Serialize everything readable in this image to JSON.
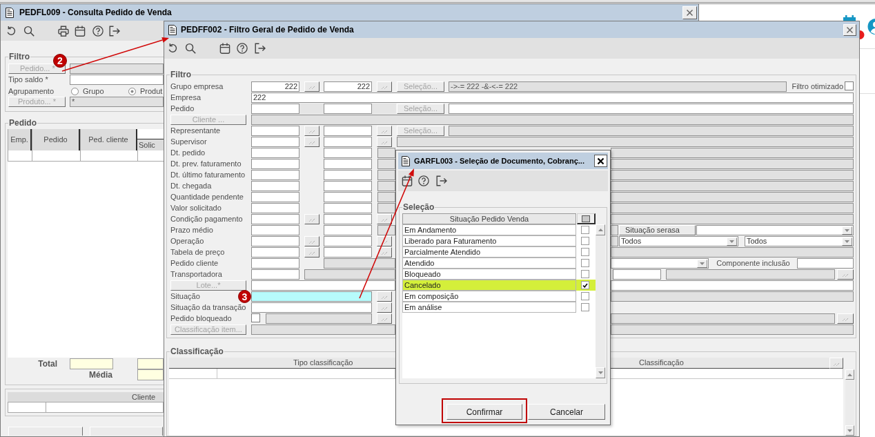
{
  "back_window": {
    "title": "PEDFL009 - Consulta Pedido de Venda",
    "filter": {
      "legend": "Filtro",
      "order_button": {
        "label": "Pedido... *",
        "disabled": true
      },
      "order_field": {
        "disabled": true
      },
      "balance_type_label": "Tipo saldo *",
      "balance_type_field": {
        "disabled": false
      },
      "grouping_label": "Agrupamento",
      "grouping_options": [
        {
          "label": "Grupo",
          "selected": false
        },
        {
          "label": "Produt",
          "selected": true
        }
      ],
      "product_button": {
        "label": "Produto... *",
        "disabled": true
      },
      "product_field": {
        "value": "*",
        "disabled": true
      }
    },
    "orders": {
      "legend": "Pedido",
      "columns": [
        "Emp.",
        "Pedido",
        "Ped. cliente"
      ],
      "column_4": "Solic",
      "total_label": "Total",
      "average_label": "Média"
    },
    "client_table": {
      "columns": [
        "Cliente"
      ]
    }
  },
  "filter_window": {
    "title": "PEDFF002 - Filtro Geral de Pedido de Venda",
    "legend": "Filtro",
    "rows": [
      {
        "label": {
          "kind": "text",
          "text": "Grupo empresa"
        },
        "cells": [
          {
            "kind": "field",
            "value": "222",
            "disabled": false,
            "focused": false
          },
          {
            "kind": "lookup"
          },
          {
            "kind": "field",
            "value": "222",
            "disabled": false,
            "focused": false
          },
          {
            "kind": "lookup"
          },
          {
            "kind": "button",
            "label": "Seleção...",
            "disabled": true
          },
          {
            "kind": "field",
            "value": "->-= 222 -&-<-= 222",
            "disabled": true,
            "focused": false
          },
          {
            "kind": "label",
            "text": "Filtro otimizado"
          },
          {
            "kind": "checkbox",
            "checked": false
          }
        ]
      },
      {
        "label": {
          "kind": "text",
          "text": "Empresa"
        },
        "cells": [
          {
            "kind": "field",
            "value": "222",
            "disabled": false,
            "focused": false
          }
        ]
      },
      {
        "label": {
          "kind": "text",
          "text": "Pedido"
        },
        "cells": [
          {
            "kind": "field",
            "disabled": false,
            "focused": false
          },
          {
            "kind": "blank"
          },
          {
            "kind": "field",
            "disabled": false,
            "focused": false
          },
          {
            "kind": "blank"
          },
          {
            "kind": "button",
            "label": "Seleção...",
            "disabled": true
          },
          {
            "kind": "field",
            "disabled": false,
            "focused": false
          }
        ]
      },
      {
        "label": {
          "kind": "button",
          "text": "Cliente ...",
          "disabled": true
        },
        "cells": [
          {
            "kind": "field",
            "disabled": true,
            "focused": false
          }
        ]
      },
      {
        "label": {
          "kind": "text",
          "text": "Representante"
        },
        "cells": [
          {
            "kind": "field",
            "disabled": false,
            "focused": false
          },
          {
            "kind": "lookup"
          },
          {
            "kind": "field",
            "disabled": false,
            "focused": false
          },
          {
            "kind": "lookup"
          },
          {
            "kind": "button",
            "label": "Seleção...",
            "disabled": true
          },
          {
            "kind": "field",
            "disabled": true,
            "focused": false
          }
        ]
      },
      {
        "label": {
          "kind": "text",
          "text": "Supervisor"
        },
        "cells": [
          {
            "kind": "field",
            "disabled": false,
            "focused": false
          },
          {
            "kind": "lookup"
          },
          {
            "kind": "field",
            "disabled": false,
            "focused": false
          },
          {
            "kind": "lookup"
          },
          {
            "kind": "field",
            "disabled": true,
            "focused": false
          }
        ]
      },
      {
        "label": {
          "kind": "text",
          "text": "Dt. pedido"
        },
        "cells": [
          {
            "kind": "field",
            "disabled": false,
            "focused": false
          },
          {
            "kind": "field",
            "disabled": false,
            "focused": false
          },
          {
            "kind": "field",
            "disabled": true,
            "focused": false
          }
        ],
        "side": [
          {
            "kind": "field",
            "disabled": true,
            "focused": false
          }
        ]
      },
      {
        "label": {
          "kind": "text",
          "text": "Dt. prev. faturamento"
        },
        "cells": [
          {
            "kind": "field",
            "disabled": false,
            "focused": false
          },
          {
            "kind": "field",
            "disabled": false,
            "focused": false
          },
          {
            "kind": "field",
            "disabled": true,
            "focused": false
          }
        ],
        "side": [
          {
            "kind": "field",
            "disabled": true,
            "focused": false
          }
        ]
      },
      {
        "label": {
          "kind": "text",
          "text": "Dt. último faturamento"
        },
        "cells": [
          {
            "kind": "field",
            "disabled": false,
            "focused": false
          },
          {
            "kind": "field",
            "disabled": false,
            "focused": false
          },
          {
            "kind": "field",
            "disabled": true,
            "focused": false
          }
        ],
        "side": [
          {
            "kind": "field",
            "disabled": true,
            "focused": false
          }
        ]
      },
      {
        "label": {
          "kind": "text",
          "text": "Dt. chegada"
        },
        "cells": [
          {
            "kind": "field",
            "disabled": false,
            "focused": false
          },
          {
            "kind": "field",
            "disabled": false,
            "focused": false
          },
          {
            "kind": "field",
            "disabled": true,
            "focused": false
          }
        ],
        "side": [
          {
            "kind": "field",
            "disabled": true,
            "focused": false
          }
        ]
      },
      {
        "label": {
          "kind": "text",
          "text": "Quantidade pendente"
        },
        "cells": [
          {
            "kind": "field",
            "disabled": false,
            "focused": false
          },
          {
            "kind": "field",
            "disabled": false,
            "focused": false
          },
          {
            "kind": "field",
            "disabled": true,
            "focused": false
          }
        ],
        "side": [
          {
            "kind": "field",
            "disabled": true,
            "focused": false
          }
        ]
      },
      {
        "label": {
          "kind": "text",
          "text": "Valor solicitado"
        },
        "cells": [
          {
            "kind": "field",
            "disabled": false,
            "focused": false
          },
          {
            "kind": "field",
            "disabled": false,
            "focused": false
          },
          {
            "kind": "field",
            "disabled": true,
            "focused": false
          }
        ],
        "side": [
          {
            "kind": "field",
            "disabled": true,
            "focused": false
          }
        ]
      },
      {
        "label": {
          "kind": "text",
          "text": "Condição pagamento"
        },
        "cells": [
          {
            "kind": "field",
            "disabled": false,
            "focused": false
          },
          {
            "kind": "lookup"
          },
          {
            "kind": "field",
            "disabled": false,
            "focused": false
          },
          {
            "kind": "lookup"
          }
        ],
        "side": [
          {
            "kind": "field",
            "disabled": true,
            "focused": false
          }
        ]
      },
      {
        "label": {
          "kind": "text",
          "text": "Prazo médio"
        },
        "cells": [
          {
            "kind": "field",
            "disabled": false,
            "focused": false
          },
          {
            "kind": "field",
            "disabled": false,
            "focused": false
          },
          {
            "kind": "field",
            "disabled": true,
            "focused": false
          }
        ],
        "side_lead": {
          "disabled": true
        },
        "side": [
          {
            "kind": "button",
            "label": "Situação serasa",
            "disabled": false
          },
          {
            "kind": "dropdown"
          }
        ]
      },
      {
        "label": {
          "kind": "text",
          "text": "Operação"
        },
        "cells": [
          {
            "kind": "field",
            "disabled": false,
            "focused": false
          },
          {
            "kind": "lookup"
          },
          {
            "kind": "field",
            "disabled": false,
            "focused": false
          },
          {
            "kind": "lookup"
          }
        ],
        "side_lead": {
          "disabled": true
        },
        "side": [
          {
            "kind": "dropdown",
            "value": "Todos"
          },
          {
            "kind": "dropdown",
            "value": "Todos"
          }
        ]
      },
      {
        "label": {
          "kind": "text",
          "text": "Tabela de preço"
        },
        "cells": [
          {
            "kind": "field",
            "disabled": false,
            "focused": false
          },
          {
            "kind": "lookup"
          },
          {
            "kind": "field",
            "disabled": false,
            "focused": false
          },
          {
            "kind": "lookup"
          }
        ],
        "side": [
          {
            "kind": "field",
            "disabled": true,
            "focused": false
          }
        ]
      },
      {
        "label": {
          "kind": "text",
          "text": "Pedido cliente"
        },
        "cells": [
          {
            "kind": "field",
            "disabled": false,
            "focused": false
          },
          {
            "kind": "field",
            "disabled": true,
            "focused": false
          }
        ],
        "side": [
          {
            "kind": "dropdown"
          },
          {
            "kind": "label",
            "text": "Componente inclusão"
          },
          {
            "kind": "field",
            "disabled": false,
            "focused": false
          }
        ]
      },
      {
        "label": {
          "kind": "text",
          "text": "Transportadora"
        },
        "cells": [
          {
            "kind": "field",
            "disabled": false,
            "focused": false
          },
          {
            "kind": "field",
            "disabled": true,
            "focused": false
          }
        ],
        "side": [
          {
            "kind": "field",
            "disabled": false,
            "focused": false
          },
          {
            "kind": "field",
            "disabled": true,
            "focused": false
          },
          {
            "kind": "lookup"
          }
        ]
      },
      {
        "label": {
          "kind": "button",
          "text": "Lote...*",
          "disabled": true
        },
        "cells": [
          {
            "kind": "field",
            "disabled": false,
            "focused": false
          }
        ],
        "side": [
          {
            "kind": "field",
            "disabled": false,
            "focused": false
          }
        ]
      },
      {
        "label": {
          "kind": "text",
          "text": "Situação"
        },
        "cells": [
          {
            "kind": "field",
            "disabled": false,
            "focused": true
          },
          {
            "kind": "lookup"
          }
        ],
        "side": [
          {
            "kind": "field",
            "disabled": true,
            "focused": false
          }
        ]
      },
      {
        "label": {
          "kind": "text",
          "text": "Situação da transação"
        },
        "cells": [
          {
            "kind": "field",
            "disabled": false,
            "focused": false
          },
          {
            "kind": "lookup"
          }
        ]
      },
      {
        "label": {
          "kind": "text",
          "text": "Pedido bloqueado"
        },
        "cells": [
          {
            "kind": "checkbox",
            "checked": false
          },
          {
            "kind": "field",
            "disabled": true,
            "focused": false
          },
          {
            "kind": "lookup"
          }
        ],
        "side": [
          {
            "kind": "field",
            "disabled": true,
            "focused": false
          },
          {
            "kind": "lookup"
          }
        ]
      },
      {
        "label": {
          "kind": "button",
          "text": "Classificação item...",
          "disabled": true
        },
        "cells": [
          {
            "kind": "field",
            "disabled": true,
            "focused": false
          }
        ],
        "side": [
          {
            "kind": "field",
            "disabled": true,
            "focused": false
          }
        ]
      }
    ],
    "classification": {
      "legend": "Classificação",
      "columns": [
        "Tipo classificação",
        "Classificação"
      ]
    }
  },
  "selection_window": {
    "title": "GARFL003 - Seleção de Documento, Cobranç...",
    "legend": "Seleção",
    "column": "Situação Pedido Venda",
    "items": [
      {
        "label": "Em Andamento",
        "checked": false,
        "selected": false
      },
      {
        "label": "Liberado para Faturamento",
        "checked": false,
        "selected": false
      },
      {
        "label": "Parcialmente Atendido",
        "checked": false,
        "selected": false
      },
      {
        "label": "Atendido",
        "checked": false,
        "selected": false
      },
      {
        "label": "Bloqueado",
        "checked": false,
        "selected": false
      },
      {
        "label": "Cancelado",
        "checked": true,
        "selected": true
      },
      {
        "label": "Em composição",
        "checked": false,
        "selected": false
      },
      {
        "label": "Em análise",
        "checked": false,
        "selected": false
      }
    ],
    "buttons": [
      {
        "label": "Confirmar",
        "highlighted": true
      },
      {
        "label": "Cancelar",
        "highlighted": false
      }
    ]
  },
  "annotations": [
    {
      "number": "2"
    },
    {
      "number": "3"
    }
  ]
}
